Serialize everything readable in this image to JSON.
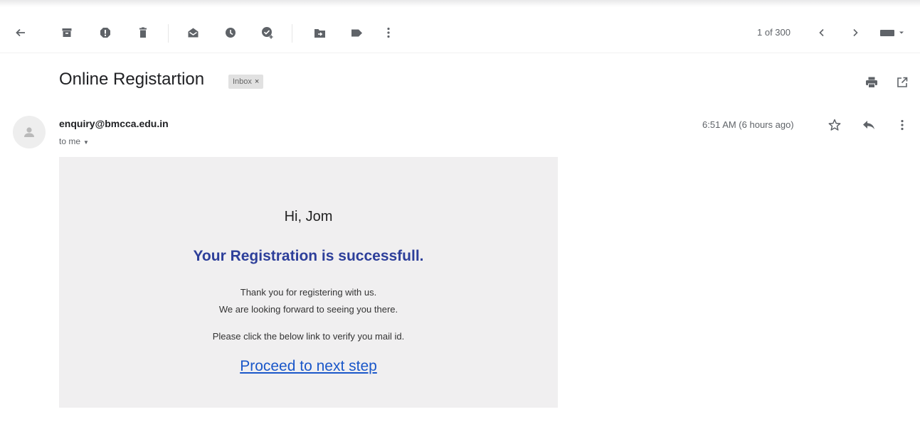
{
  "toolbar": {
    "icons": [
      "back-arrow-icon",
      "archive-icon",
      "report-spam-icon",
      "delete-icon",
      "mark-unread-icon",
      "snooze-icon",
      "add-to-tasks-icon",
      "move-to-icon",
      "labels-icon",
      "more-vert-icon"
    ],
    "pager": "1 of 300",
    "right_icons": [
      "chevron-left-icon",
      "chevron-right-icon",
      "input-tools-icon"
    ]
  },
  "email": {
    "subject": "Online Registartion",
    "label": "Inbox",
    "label_close": "×",
    "sender": "enquiry@bmcca.edu.in",
    "to": "to me",
    "time": "6:51 AM (6 hours ago)",
    "header_icons": [
      "print-icon",
      "open-in-new-window-icon"
    ],
    "action_icons": [
      "star-icon",
      "reply-icon",
      "more-vert-icon"
    ]
  },
  "body": {
    "greeting": "Hi, Jom",
    "headline": "Your Registration is successfull.",
    "line1": "Thank you for registering with us.",
    "line2": "We are looking forward to seeing you there.",
    "line3": "Please click the below link to verify you mail id.",
    "link": "Proceed to next step"
  },
  "colors": {
    "headline": "#2d3f9a",
    "link": "#1a57c9",
    "card_bg": "#f0eff0",
    "icon": "#5f6368"
  }
}
